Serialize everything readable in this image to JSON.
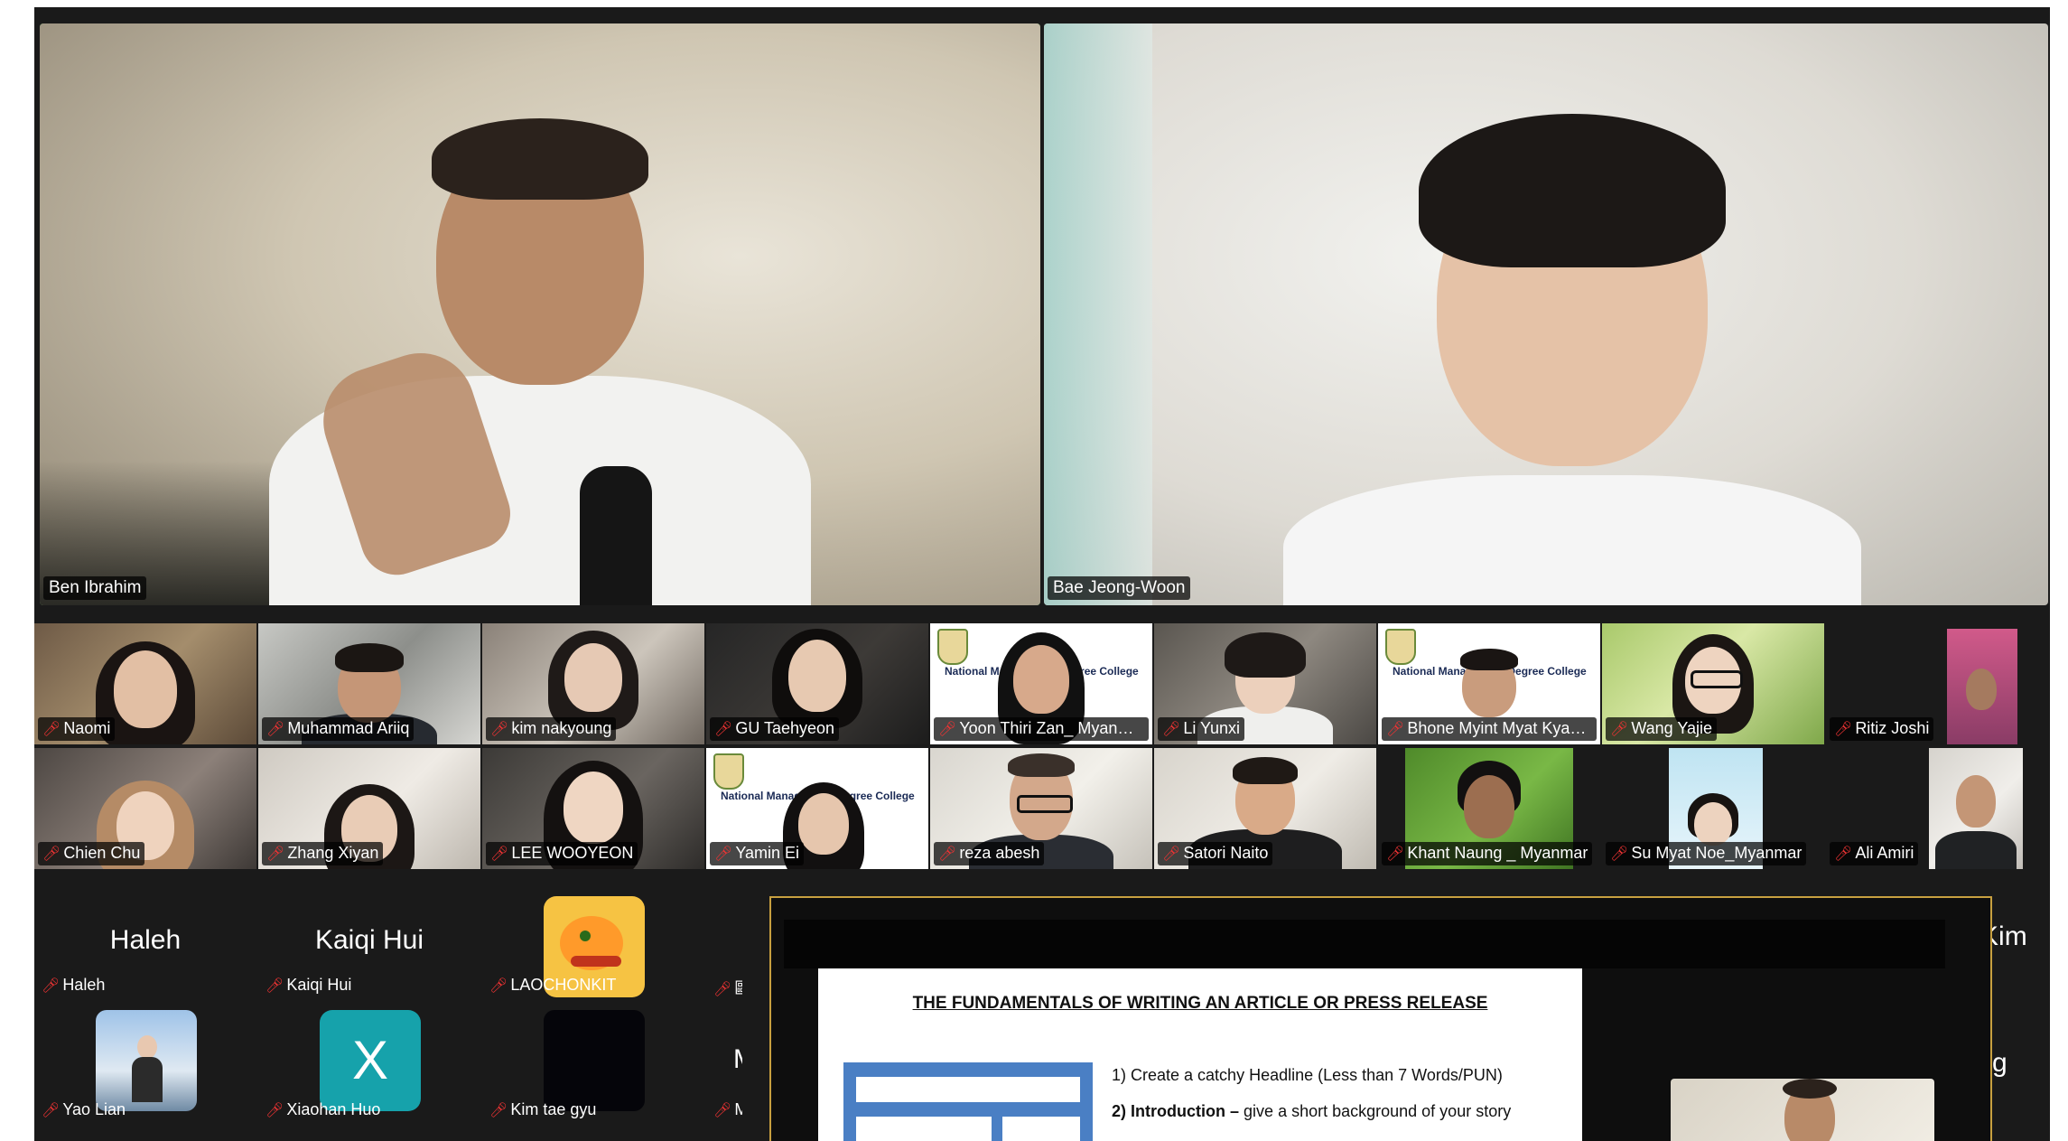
{
  "speakers": [
    {
      "name": "Ben Ibrahim",
      "active": true
    },
    {
      "name": "Bae Jeong-Woon",
      "active": false
    }
  ],
  "gallery_row1": [
    {
      "name": "Naomi"
    },
    {
      "name": "Muhammad Ariiq"
    },
    {
      "name": "kim nakyoung"
    },
    {
      "name": "GU Taehyeon"
    },
    {
      "name": "Yoon Thiri Zan_ Myanmar",
      "college_text": "National Management Degree College"
    },
    {
      "name": "Li Yunxi"
    },
    {
      "name": "Bhone Myint Myat Kyaw...",
      "college_text": "National Management Degree College"
    },
    {
      "name": "Wang Yajie"
    },
    {
      "name": "Ritiz Joshi"
    }
  ],
  "gallery_row2": [
    {
      "name": "Chien Chu"
    },
    {
      "name": "Zhang Xiyan"
    },
    {
      "name": "LEE WOOYEON"
    },
    {
      "name": "Yamin Ei",
      "college_text": "National Management Degree College"
    },
    {
      "name": "reza abesh"
    },
    {
      "name": "Satori Naito"
    },
    {
      "name": "Khant Naung _ Myanmar"
    },
    {
      "name": "Su Myat Noe_Myanmar"
    },
    {
      "name": "Ali Amiri"
    }
  ],
  "camera_off_row1": [
    {
      "display": "Haleh",
      "name": "Haleh"
    },
    {
      "display": "Kaiqi Hui",
      "name": "Kaiqi Hui"
    },
    {
      "display": "",
      "name": "LAOCHONKIT"
    },
    {
      "display": "",
      "name": "歐陽"
    }
  ],
  "camera_off_row2": [
    {
      "name": "Yao Lian"
    },
    {
      "name": "Xiaohan Huo",
      "avatar_letter": "X"
    },
    {
      "name": "Kim tae gyu"
    },
    {
      "name": "Muh",
      "display": "M"
    }
  ],
  "partial_names": {
    "right_top": "g Kim",
    "right_bottom": "uang"
  },
  "shared_screen": {
    "doc_title": "THE FUNDAMENTALS OF WRITING AN ARTICLE OR PRESS RELEASE",
    "item1": "1)  Create a catchy Headline (Less than 7 Words/PUN)",
    "item2_num": "2)",
    "item2_bold": "Introduction –",
    "item2_rest": "give a short background of your story"
  },
  "colors": {
    "active_speaker_border": "#3fbf4a",
    "share_border": "#c8a040",
    "muted_mic": "#e33333"
  }
}
